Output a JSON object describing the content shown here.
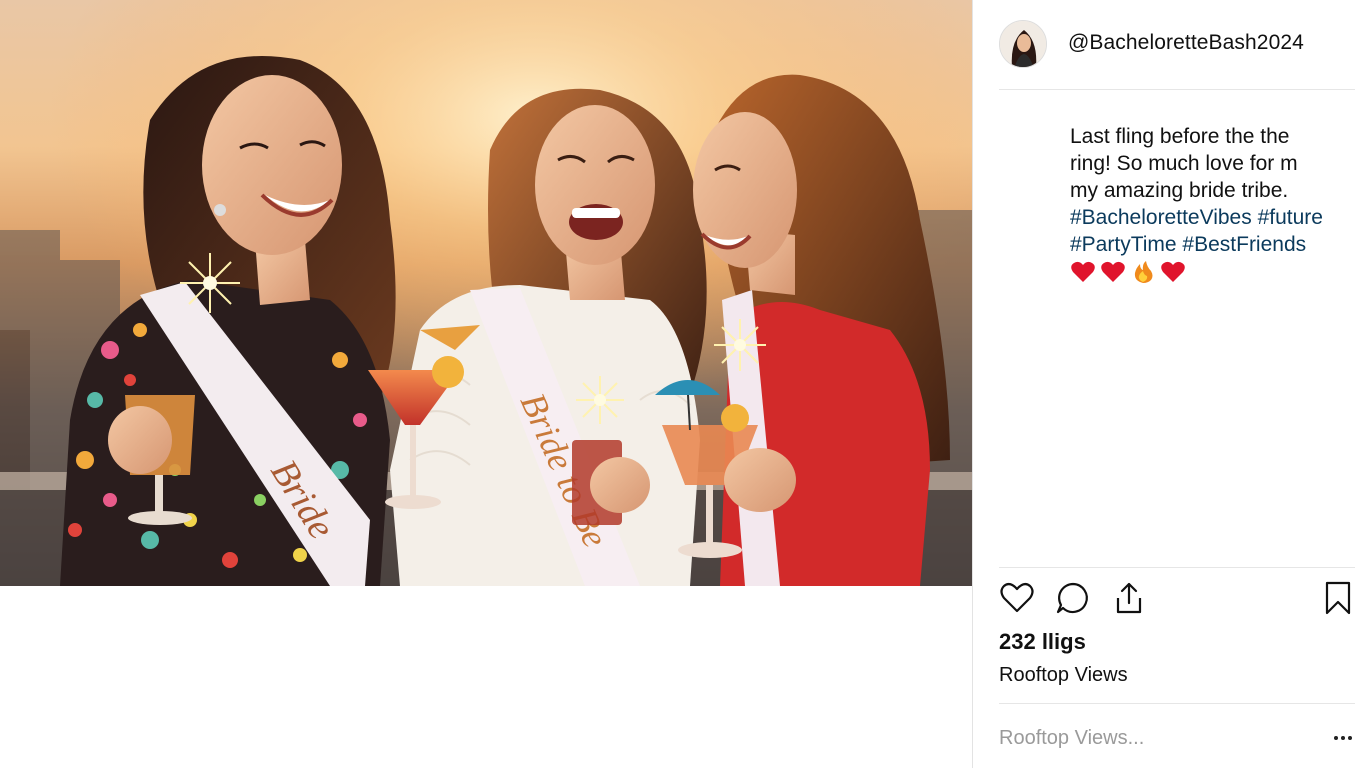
{
  "post": {
    "username": "@BacheloretteBash2024",
    "caption": {
      "lines": [
        "Last fling before the the",
        "ring! So much love for m",
        "my amazing bride tribe."
      ],
      "hashtag_lines": [
        "#BacheloretteVibes #future",
        "#PartyTime #BestFriends"
      ],
      "emojis": [
        "red-heart",
        "red-heart",
        "fire",
        "red-heart"
      ]
    },
    "likes": "232 lligs",
    "location": "Rooftop Views",
    "comment_placeholder": "Rooftop Views..."
  },
  "photo": {
    "sash_left": "Bride",
    "sash_center": "Bride to Be"
  },
  "icons": {
    "like": "heart-outline-icon",
    "comment": "speech-bubble-icon",
    "share": "share-upload-icon",
    "save": "bookmark-icon",
    "more": "more-horizontal-icon"
  },
  "colors": {
    "hashtag": "#0b3a5c",
    "placeholder": "#9a9a9a",
    "divider": "#e6e6e6",
    "heart": "#e0142c"
  }
}
